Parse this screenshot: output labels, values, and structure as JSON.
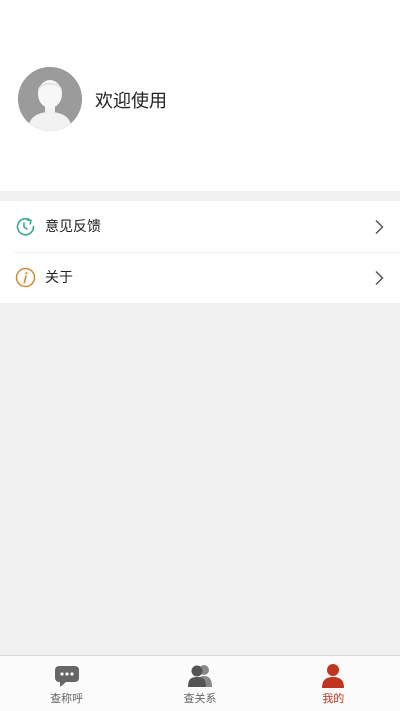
{
  "profile": {
    "avatar_icon": "user-avatar-icon",
    "welcome_text": "欢迎使用"
  },
  "menu": {
    "items": [
      {
        "label": "意见反馈",
        "icon": "feedback-refresh-icon",
        "icon_color": "#3aa891"
      },
      {
        "label": "关于",
        "icon": "info-icon",
        "icon_color": "#d28936"
      }
    ]
  },
  "tabbar": {
    "active_color": "#c1341f",
    "inactive_color": "#666666",
    "tabs": [
      {
        "label": "查称呼",
        "icon": "chat-bubble-icon",
        "active": false
      },
      {
        "label": "查关系",
        "icon": "users-icon",
        "active": false
      },
      {
        "label": "我的",
        "icon": "person-icon",
        "active": true
      }
    ]
  }
}
